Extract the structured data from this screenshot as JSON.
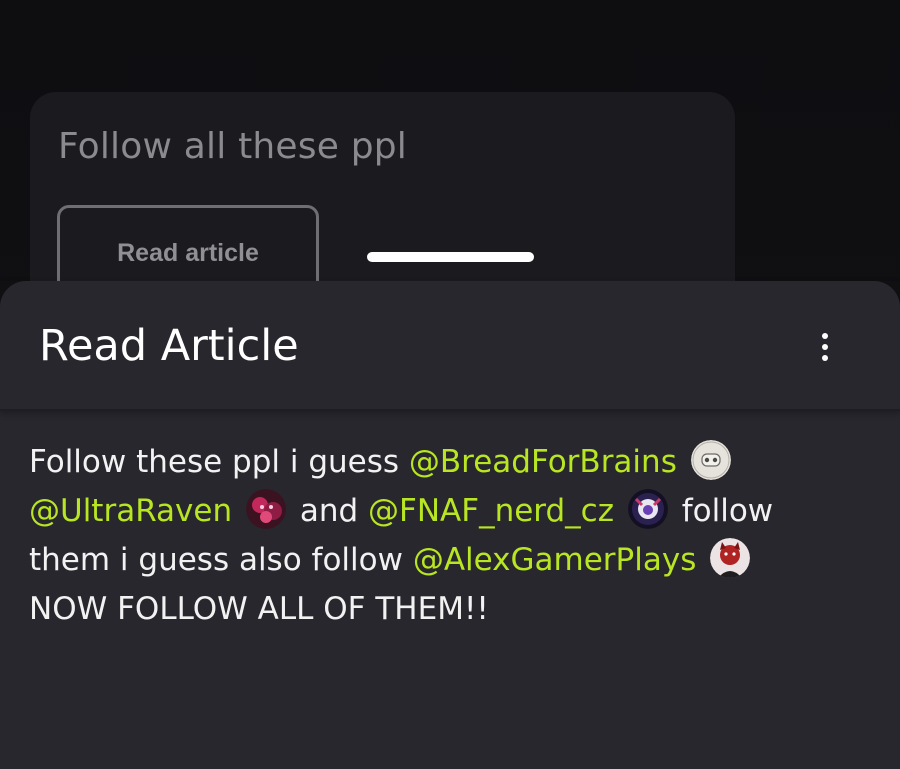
{
  "background_card": {
    "title": "Follow all these ppl",
    "read_button_label": "Read article"
  },
  "sheet": {
    "title": "Read Article",
    "menu_icon": "more-vertical-icon"
  },
  "article": {
    "text_1": "Follow these ppl i guess",
    "mention_1": "@BreadForBrains",
    "mention_2": "@UltraRaven",
    "text_2": "and",
    "mention_3": "@FNAF_nerd_cz",
    "text_3": "follow",
    "text_4": "them i guess also follow",
    "mention_4": "@AlexGamerPlays",
    "text_5": "NOW FOLLOW ALL OF THEM!!"
  },
  "colors": {
    "sheet_bg": "#28272e",
    "mention": "#b8e622",
    "text": "#f2f2f2"
  }
}
